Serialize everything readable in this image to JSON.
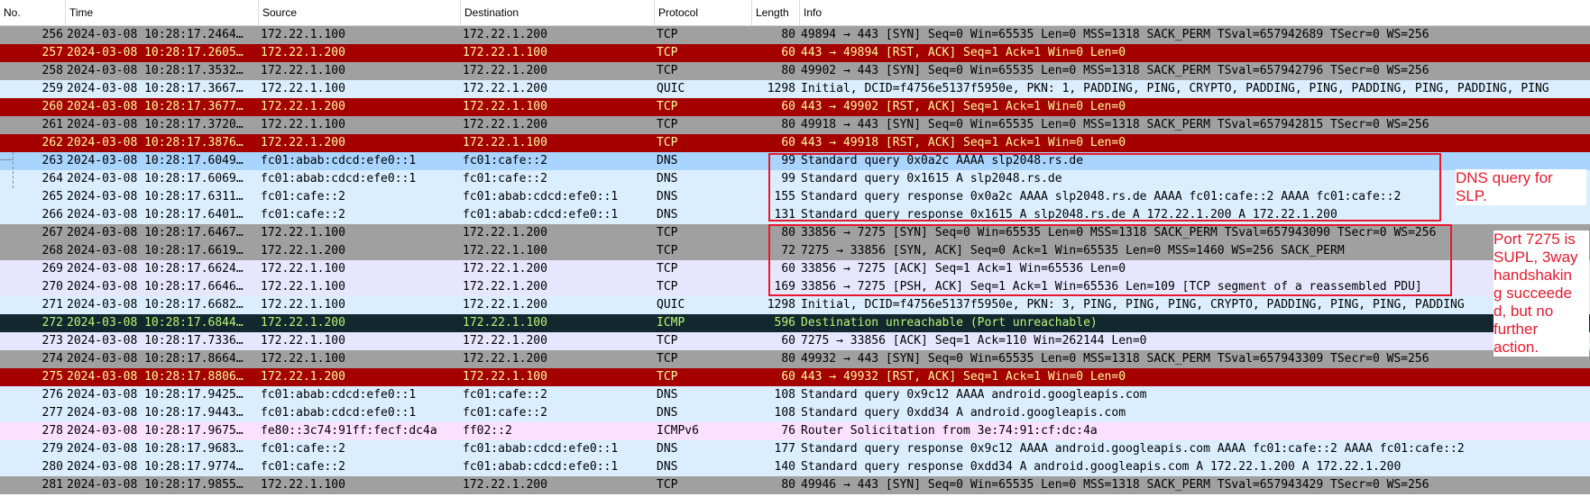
{
  "columns": {
    "no": "No.",
    "time": "Time",
    "source": "Source",
    "destination": "Destination",
    "protocol": "Protocol",
    "length": "Length",
    "info": "Info"
  },
  "colors": {
    "tcp_gray": "#a0a0a0",
    "rst_red": "#a40000",
    "rst_text": "#fffc9c",
    "quic_blue": "#daeeff",
    "dns_blue": "#daeeff",
    "selected_blue": "#a8d4ff",
    "icmp_dark": "#12272e",
    "icmp_text": "#b7f774",
    "tcp_lavender": "#e7e6ff",
    "icmpv6_pink": "#fce0ff",
    "annotation_red": "#e8192c"
  },
  "packets": [
    {
      "no": "256",
      "time": "2024-03-08 10:28:17.2464…",
      "src": "172.22.1.100",
      "dst": "172.22.1.200",
      "proto": "TCP",
      "len": "80",
      "info": "49894 → 443 [SYN] Seq=0 Win=65535 Len=0 MSS=1318 SACK_PERM TSval=657942689 TSecr=0 WS=256",
      "style": "gray"
    },
    {
      "no": "257",
      "time": "2024-03-08 10:28:17.2605…",
      "src": "172.22.1.200",
      "dst": "172.22.1.100",
      "proto": "TCP",
      "len": "60",
      "info": "443 → 49894 [RST, ACK] Seq=1 Ack=1 Win=0 Len=0",
      "style": "rst"
    },
    {
      "no": "258",
      "time": "2024-03-08 10:28:17.3532…",
      "src": "172.22.1.100",
      "dst": "172.22.1.200",
      "proto": "TCP",
      "len": "80",
      "info": "49902 → 443 [SYN] Seq=0 Win=65535 Len=0 MSS=1318 SACK_PERM TSval=657942796 TSecr=0 WS=256",
      "style": "gray"
    },
    {
      "no": "259",
      "time": "2024-03-08 10:28:17.3667…",
      "src": "172.22.1.100",
      "dst": "172.22.1.200",
      "proto": "QUIC",
      "len": "1298",
      "info": "Initial, DCID=f4756e5137f5950e, PKN: 1, PADDING, PING, CRYPTO, PADDING, PING, PADDING, PING, PADDING, PING",
      "style": "quic"
    },
    {
      "no": "260",
      "time": "2024-03-08 10:28:17.3677…",
      "src": "172.22.1.200",
      "dst": "172.22.1.100",
      "proto": "TCP",
      "len": "60",
      "info": "443 → 49902 [RST, ACK] Seq=1 Ack=1 Win=0 Len=0",
      "style": "rst"
    },
    {
      "no": "261",
      "time": "2024-03-08 10:28:17.3720…",
      "src": "172.22.1.100",
      "dst": "172.22.1.200",
      "proto": "TCP",
      "len": "80",
      "info": "49918 → 443 [SYN] Seq=0 Win=65535 Len=0 MSS=1318 SACK_PERM TSval=657942815 TSecr=0 WS=256",
      "style": "gray"
    },
    {
      "no": "262",
      "time": "2024-03-08 10:28:17.3876…",
      "src": "172.22.1.200",
      "dst": "172.22.1.100",
      "proto": "TCP",
      "len": "60",
      "info": "443 → 49918 [RST, ACK] Seq=1 Ack=1 Win=0 Len=0",
      "style": "rst"
    },
    {
      "no": "263",
      "time": "2024-03-08 10:28:17.6049…",
      "src": "fc01:abab:cdcd:efe0::1",
      "dst": "fc01:cafe::2",
      "proto": "DNS",
      "len": "99",
      "info": "Standard query 0x0a2c AAAA slp2048.rs.de",
      "style": "selected"
    },
    {
      "no": "264",
      "time": "2024-03-08 10:28:17.6069…",
      "src": "fc01:abab:cdcd:efe0::1",
      "dst": "fc01:cafe::2",
      "proto": "DNS",
      "len": "99",
      "info": "Standard query 0x1615 A slp2048.rs.de",
      "style": "dns"
    },
    {
      "no": "265",
      "time": "2024-03-08 10:28:17.6311…",
      "src": "fc01:cafe::2",
      "dst": "fc01:abab:cdcd:efe0::1",
      "proto": "DNS",
      "len": "155",
      "info": "Standard query response 0x0a2c AAAA slp2048.rs.de AAAA fc01:cafe::2 AAAA fc01:cafe::2",
      "style": "dns"
    },
    {
      "no": "266",
      "time": "2024-03-08 10:28:17.6401…",
      "src": "fc01:cafe::2",
      "dst": "fc01:abab:cdcd:efe0::1",
      "proto": "DNS",
      "len": "131",
      "info": "Standard query response 0x1615 A slp2048.rs.de A 172.22.1.200 A 172.22.1.200",
      "style": "dns"
    },
    {
      "no": "267",
      "time": "2024-03-08 10:28:17.6467…",
      "src": "172.22.1.100",
      "dst": "172.22.1.200",
      "proto": "TCP",
      "len": "80",
      "info": "33856 → 7275 [SYN] Seq=0 Win=65535 Len=0 MSS=1318 SACK_PERM TSval=657943090 TSecr=0 WS=256",
      "style": "gray"
    },
    {
      "no": "268",
      "time": "2024-03-08 10:28:17.6619…",
      "src": "172.22.1.200",
      "dst": "172.22.1.100",
      "proto": "TCP",
      "len": "72",
      "info": "7275 → 33856 [SYN, ACK] Seq=0 Ack=1 Win=65535 Len=0 MSS=1460 WS=256 SACK_PERM",
      "style": "gray"
    },
    {
      "no": "269",
      "time": "2024-03-08 10:28:17.6624…",
      "src": "172.22.1.100",
      "dst": "172.22.1.200",
      "proto": "TCP",
      "len": "60",
      "info": "33856 → 7275 [ACK] Seq=1 Ack=1 Win=65536 Len=0",
      "style": "lavender"
    },
    {
      "no": "270",
      "time": "2024-03-08 10:28:17.6646…",
      "src": "172.22.1.100",
      "dst": "172.22.1.200",
      "proto": "TCP",
      "len": "169",
      "info": "33856 → 7275 [PSH, ACK] Seq=1 Ack=1 Win=65536 Len=109 [TCP segment of a reassembled PDU]",
      "style": "lavender"
    },
    {
      "no": "271",
      "time": "2024-03-08 10:28:17.6682…",
      "src": "172.22.1.100",
      "dst": "172.22.1.200",
      "proto": "QUIC",
      "len": "1298",
      "info": "Initial, DCID=f4756e5137f5950e, PKN: 3, PING, PING, PING, CRYPTO, PADDING, PING, PING, PADDING",
      "style": "quic"
    },
    {
      "no": "272",
      "time": "2024-03-08 10:28:17.6844…",
      "src": "172.22.1.200",
      "dst": "172.22.1.100",
      "proto": "ICMP",
      "len": "596",
      "info": "Destination unreachable (Port unreachable)",
      "style": "icmp"
    },
    {
      "no": "273",
      "time": "2024-03-08 10:28:17.7336…",
      "src": "172.22.1.100",
      "dst": "172.22.1.200",
      "proto": "TCP",
      "len": "60",
      "info": "7275 → 33856 [ACK] Seq=1 Ack=110 Win=262144 Len=0",
      "style": "lavender"
    },
    {
      "no": "274",
      "time": "2024-03-08 10:28:17.8664…",
      "src": "172.22.1.100",
      "dst": "172.22.1.200",
      "proto": "TCP",
      "len": "80",
      "info": "49932 → 443 [SYN] Seq=0 Win=65535 Len=0 MSS=1318 SACK_PERM TSval=657943309 TSecr=0 WS=256",
      "style": "gray"
    },
    {
      "no": "275",
      "time": "2024-03-08 10:28:17.8806…",
      "src": "172.22.1.200",
      "dst": "172.22.1.100",
      "proto": "TCP",
      "len": "60",
      "info": "443 → 49932 [RST, ACK] Seq=1 Ack=1 Win=0 Len=0",
      "style": "rst"
    },
    {
      "no": "276",
      "time": "2024-03-08 10:28:17.9425…",
      "src": "fc01:abab:cdcd:efe0::1",
      "dst": "fc01:cafe::2",
      "proto": "DNS",
      "len": "108",
      "info": "Standard query 0x9c12 AAAA android.googleapis.com",
      "style": "dns"
    },
    {
      "no": "277",
      "time": "2024-03-08 10:28:17.9443…",
      "src": "fc01:abab:cdcd:efe0::1",
      "dst": "fc01:cafe::2",
      "proto": "DNS",
      "len": "108",
      "info": "Standard query 0xdd34 A android.googleapis.com",
      "style": "dns"
    },
    {
      "no": "278",
      "time": "2024-03-08 10:28:17.9675…",
      "src": "fe80::3c74:91ff:fecf:dc4a",
      "dst": "ff02::2",
      "proto": "ICMPv6",
      "len": "76",
      "info": "Router Solicitation from 3e:74:91:cf:dc:4a",
      "style": "icmpv6"
    },
    {
      "no": "279",
      "time": "2024-03-08 10:28:17.9683…",
      "src": "fc01:cafe::2",
      "dst": "fc01:abab:cdcd:efe0::1",
      "proto": "DNS",
      "len": "177",
      "info": "Standard query response 0x9c12 AAAA android.googleapis.com AAAA fc01:cafe::2 AAAA fc01:cafe::2",
      "style": "dns"
    },
    {
      "no": "280",
      "time": "2024-03-08 10:28:17.9774…",
      "src": "fc01:cafe::2",
      "dst": "fc01:abab:cdcd:efe0::1",
      "proto": "DNS",
      "len": "140",
      "info": "Standard query response 0xdd34 A android.googleapis.com A 172.22.1.200 A 172.22.1.200",
      "style": "dns"
    },
    {
      "no": "281",
      "time": "2024-03-08 10:28:17.9855…",
      "src": "172.22.1.100",
      "dst": "172.22.1.200",
      "proto": "TCP",
      "len": "80",
      "info": "49946 → 443 [SYN] Seq=0 Win=65535 Len=0 MSS=1318 SACK_PERM TSval=657943429 TSecr=0 WS=256",
      "style": "gray"
    }
  ],
  "annotations": {
    "dns_note": "DNS query for\nSLP.",
    "supl_note": "Port 7275 is\nSUPL, 3way\nhandshakin\ng succeede\nd, but no\nfurther\naction."
  }
}
